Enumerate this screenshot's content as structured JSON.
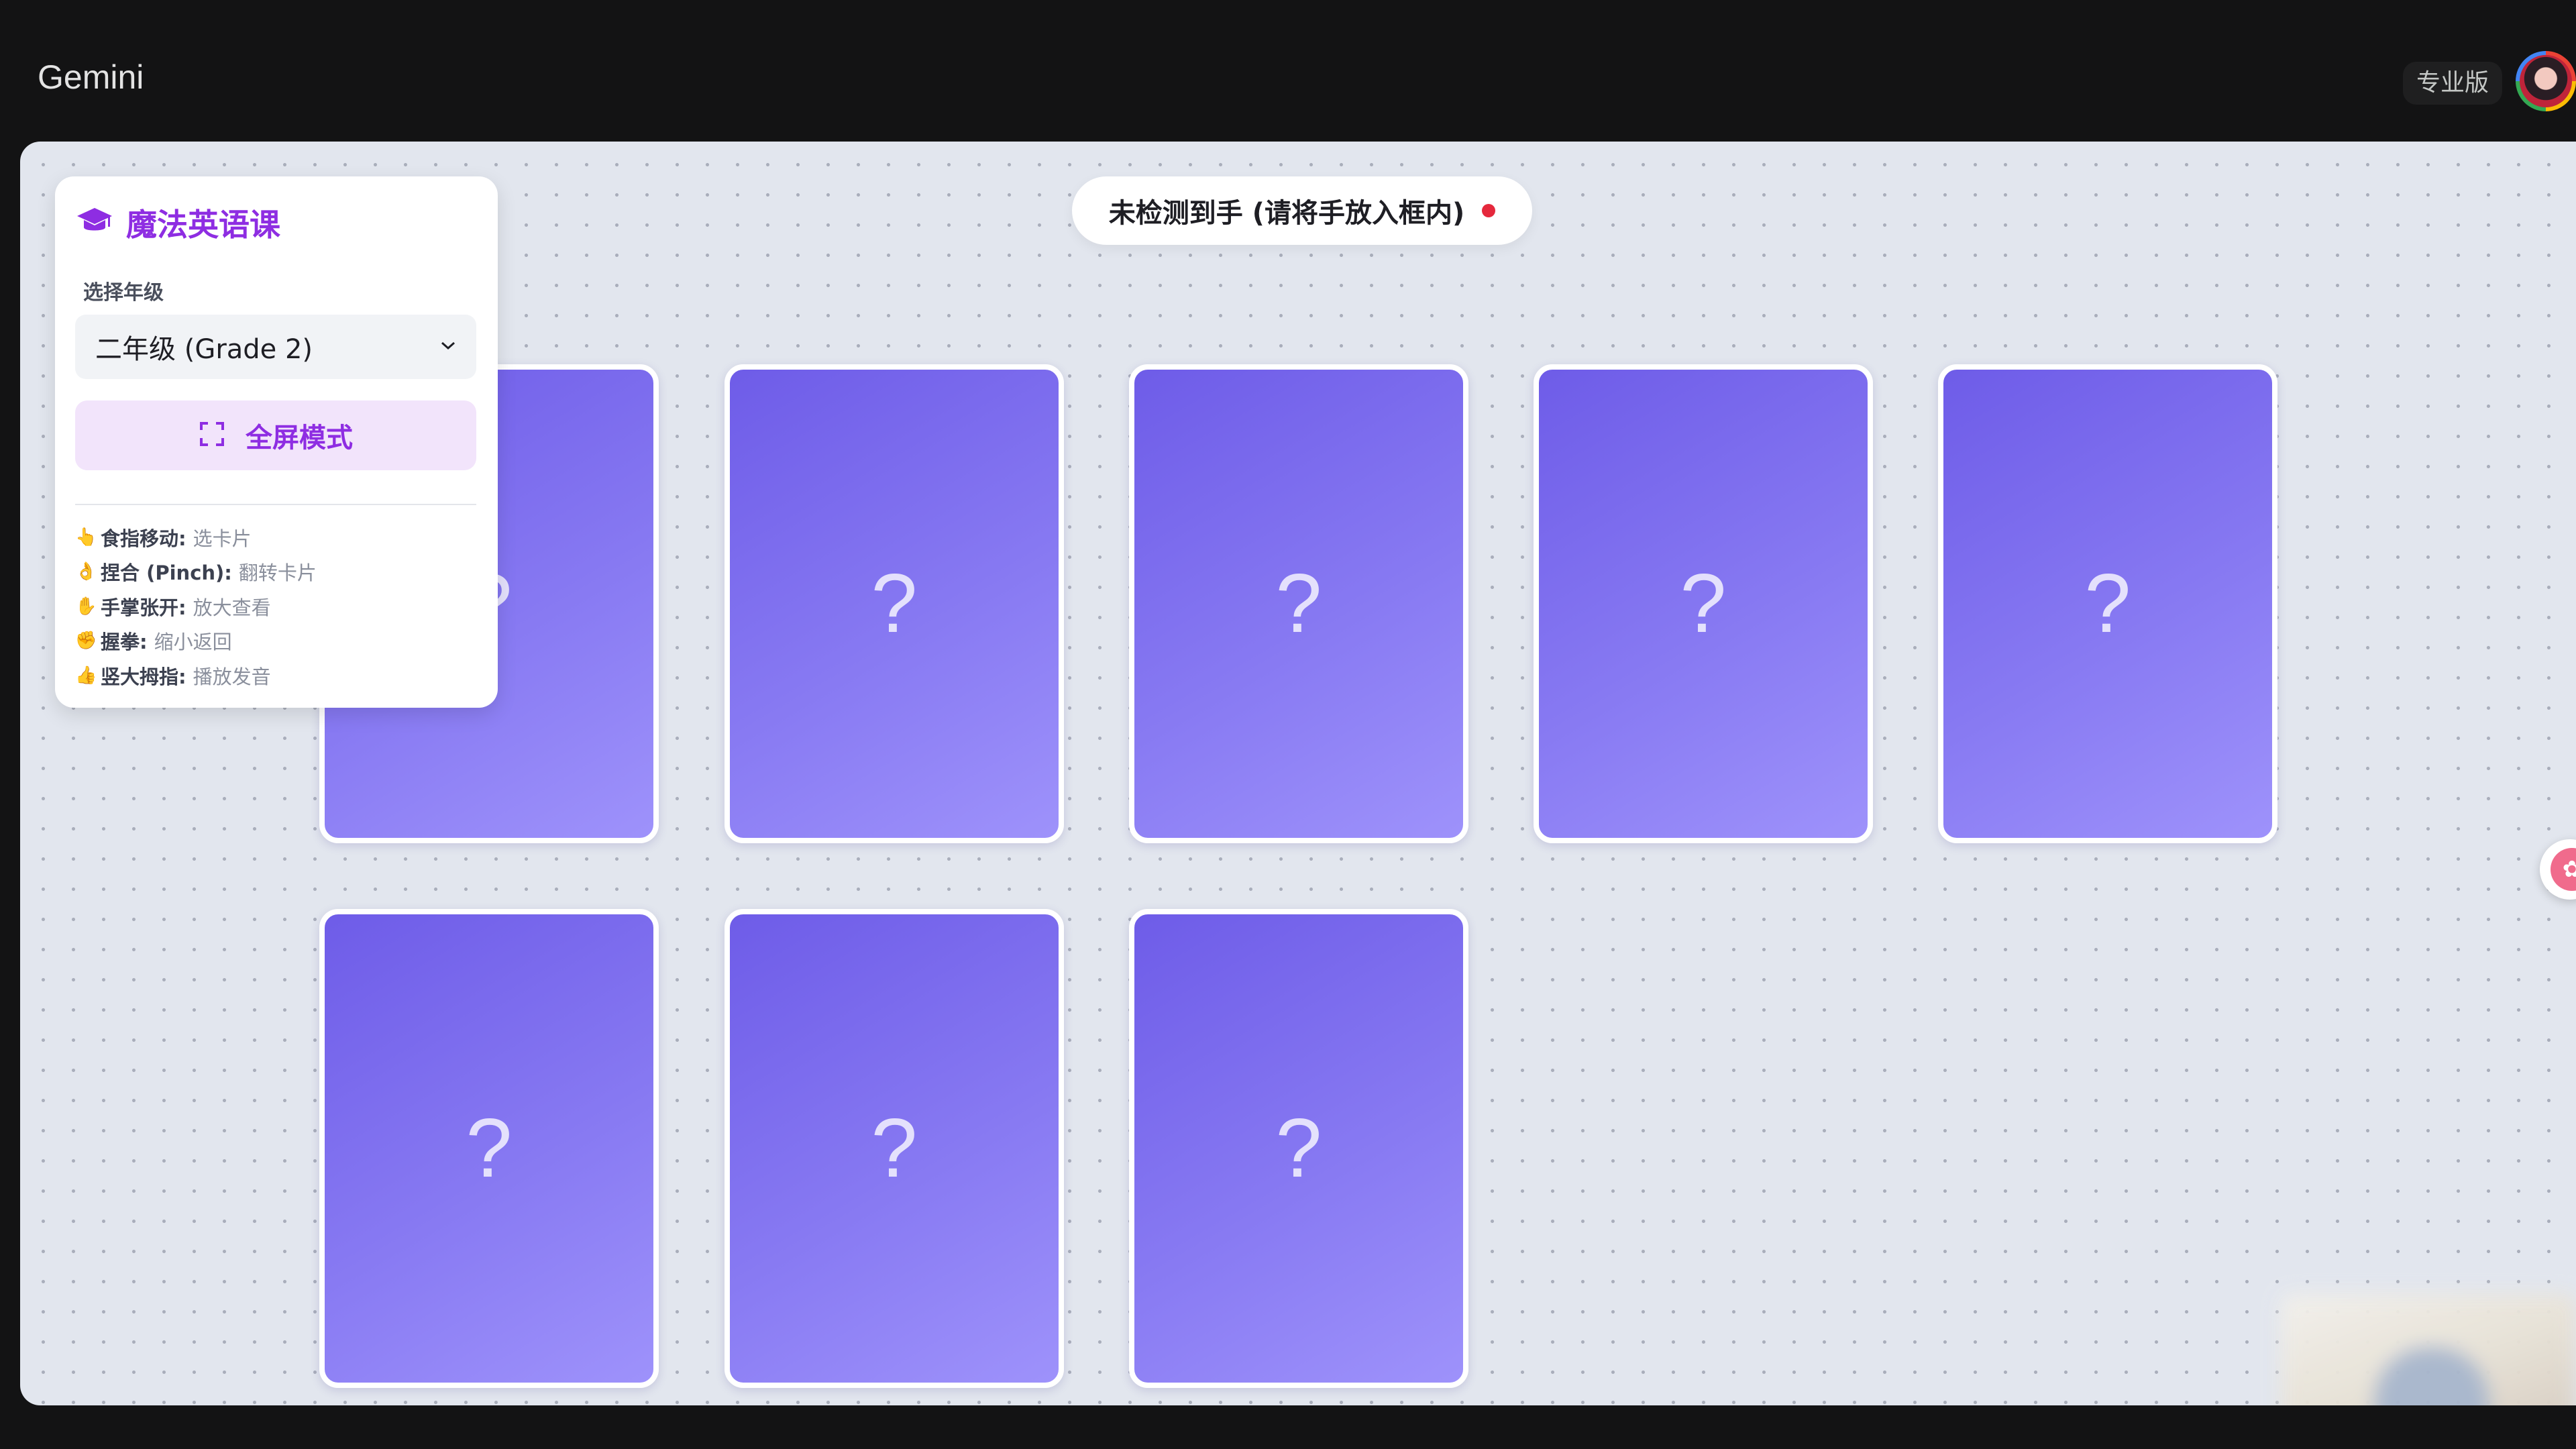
{
  "app": {
    "title": "Gemini",
    "pro_badge": "专业版"
  },
  "status": {
    "text": "未检测到手 (请将手放入框内)",
    "dot_color": "#e5283c"
  },
  "panel": {
    "title": "魔法英语课",
    "icon": "graduation-cap-icon",
    "grade_label": "选择年级",
    "grade_selected": "二年级 (Grade 2)",
    "fullscreen_label": "全屏模式",
    "gestures": [
      {
        "emoji": "👆",
        "name": "食指移动:",
        "desc": "选卡片"
      },
      {
        "emoji": "👌",
        "name": "捏合 (Pinch):",
        "desc": "翻转卡片"
      },
      {
        "emoji": "✋",
        "name": "手掌张开:",
        "desc": "放大查看"
      },
      {
        "emoji": "✊",
        "name": "握拳:",
        "desc": "缩小返回"
      },
      {
        "emoji": "👍",
        "name": "竖大拇指:",
        "desc": "播放发音"
      }
    ]
  },
  "cards": [
    {
      "mark": "?"
    },
    {
      "mark": "?"
    },
    {
      "mark": "?"
    },
    {
      "mark": "?"
    },
    {
      "mark": "?"
    },
    {
      "mark": "?"
    },
    {
      "mark": "?"
    },
    {
      "mark": "?"
    }
  ],
  "colors": {
    "accent": "#8e2de2",
    "card_gradient_start": "#6e5ce8",
    "card_gradient_end": "#9e92fb"
  }
}
